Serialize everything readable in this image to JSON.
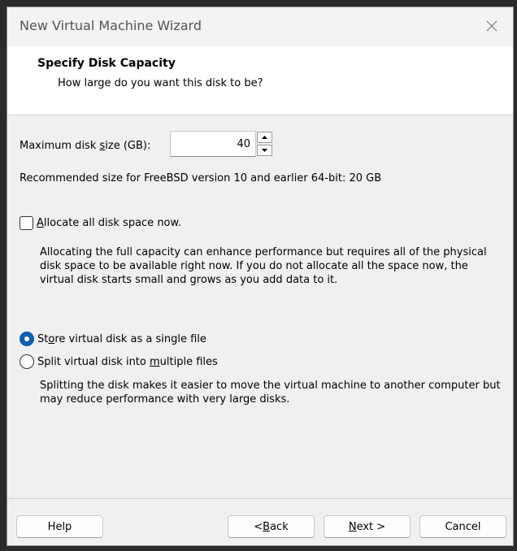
{
  "window": {
    "title": "New Virtual Machine Wizard"
  },
  "header": {
    "title": "Specify Disk Capacity",
    "subtitle": "How large do you want this disk to be?"
  },
  "disk_size": {
    "label_pre": "Maximum disk ",
    "label_accel": "s",
    "label_post": "ize (GB):",
    "value": "40"
  },
  "recommendation": "Recommended size for FreeBSD version 10 and earlier 64-bit: 20 GB",
  "allocate": {
    "accel": "A",
    "label_rest": "llocate all disk space now.",
    "checked": false,
    "description": "Allocating the full capacity can enhance performance but requires all of the physical disk space to be available right now. If you do not allocate all the space now, the virtual disk starts small and grows as you add data to it."
  },
  "storage": {
    "single": {
      "pre": "St",
      "accel": "o",
      "post": "re virtual disk as a single file",
      "selected": true
    },
    "split": {
      "pre": "Split virtual disk into ",
      "accel": "m",
      "post": "ultiple files",
      "selected": false
    },
    "description": "Splitting the disk makes it easier to move the virtual machine to another computer but may reduce performance with very large disks."
  },
  "buttons": {
    "help": "Help",
    "back_pre": "< ",
    "back_accel": "B",
    "back_post": "ack",
    "next_accel": "N",
    "next_post": "ext >",
    "cancel": "Cancel"
  },
  "colors": {
    "accent": "#0a5fb4"
  },
  "icons": {
    "close": "close-icon",
    "spin_up": "spin-up-icon",
    "spin_down": "spin-down-icon"
  }
}
